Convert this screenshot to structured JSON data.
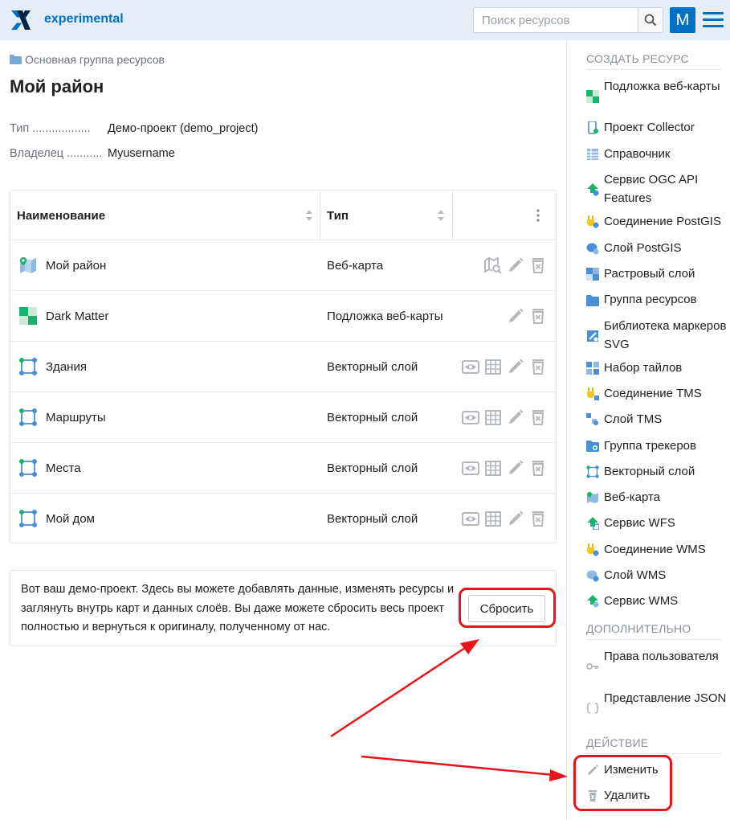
{
  "header": {
    "app_title": "experimental",
    "search_placeholder": "Поиск ресурсов",
    "avatar_letter": "M"
  },
  "breadcrumb": {
    "label": "Основная группа ресурсов"
  },
  "page": {
    "title": "Мой район",
    "meta": [
      {
        "key": "Тип ..................",
        "value": "Демо-проект (demo_project)"
      },
      {
        "key": "Владелец ...........",
        "value": "Myusername"
      }
    ]
  },
  "table": {
    "columns": {
      "name": "Наименование",
      "type": "Тип"
    },
    "rows": [
      {
        "name": "Мой район",
        "type": "Веб-карта",
        "icon": "webmap-icon",
        "actions": [
          "preview-map",
          "edit",
          "delete"
        ]
      },
      {
        "name": "Dark Matter",
        "type": "Подложка веб-карты",
        "icon": "basemap-icon",
        "actions": [
          "edit",
          "delete"
        ]
      },
      {
        "name": "Здания",
        "type": "Векторный слой",
        "icon": "vector-layer-icon",
        "actions": [
          "preview",
          "table",
          "edit",
          "delete"
        ]
      },
      {
        "name": "Маршруты",
        "type": "Векторный слой",
        "icon": "vector-layer-icon",
        "actions": [
          "preview",
          "table",
          "edit",
          "delete"
        ]
      },
      {
        "name": "Места",
        "type": "Векторный слой",
        "icon": "vector-layer-icon",
        "actions": [
          "preview",
          "table",
          "edit",
          "delete"
        ]
      },
      {
        "name": "Мой дом",
        "type": "Векторный слой",
        "icon": "vector-layer-icon",
        "actions": [
          "preview",
          "table",
          "edit",
          "delete"
        ]
      }
    ]
  },
  "notice": {
    "text": "Вот ваш демо-проект. Здесь вы можете добавлять данные, изменять ресурсы и заглянуть внутрь карт и данных слоёв. Вы даже можете сбросить весь проект полностью и вернуться к оригиналу, полученному от нас.",
    "reset_label": "Сбросить"
  },
  "sidebar": {
    "create_title": "СОЗДАТЬ РЕСУРС",
    "create_items": [
      {
        "label": "Подложка веб-карты",
        "icon": "basemap-icon"
      },
      {
        "label": "Проект Collector",
        "icon": "collector-icon"
      },
      {
        "label": "Справочник",
        "icon": "lookup-table-icon"
      },
      {
        "label": "Сервис OGC API Features",
        "icon": "ogcf-service-icon"
      },
      {
        "label": "Соединение PostGIS",
        "icon": "postgis-connection-icon"
      },
      {
        "label": "Слой PostGIS",
        "icon": "postgis-layer-icon"
      },
      {
        "label": "Растровый слой",
        "icon": "raster-layer-icon"
      },
      {
        "label": "Группа ресурсов",
        "icon": "folder-icon"
      },
      {
        "label": "Библиотека маркеров SVG",
        "icon": "svg-marker-library-icon"
      },
      {
        "label": "Набор тайлов",
        "icon": "tileset-icon"
      },
      {
        "label": "Соединение TMS",
        "icon": "tms-connection-icon"
      },
      {
        "label": "Слой TMS",
        "icon": "tms-layer-icon"
      },
      {
        "label": "Группа трекеров",
        "icon": "tracker-group-icon"
      },
      {
        "label": "Векторный слой",
        "icon": "vector-layer-icon"
      },
      {
        "label": "Веб-карта",
        "icon": "webmap-icon"
      },
      {
        "label": "Сервис WFS",
        "icon": "wfs-service-icon"
      },
      {
        "label": "Соединение WMS",
        "icon": "wms-connection-icon"
      },
      {
        "label": "Слой WMS",
        "icon": "wms-layer-icon"
      },
      {
        "label": "Сервис WMS",
        "icon": "wms-service-icon"
      }
    ],
    "extra_title": "ДОПОЛНИТЕЛЬНО",
    "extra_items": [
      {
        "label": "Права пользователя",
        "icon": "key-icon"
      },
      {
        "label": "Представление JSON",
        "icon": "json-braces-icon"
      }
    ],
    "action_title": "ДЕЙСТВИЕ",
    "action_items": [
      {
        "label": "Изменить",
        "icon": "pencil-icon"
      },
      {
        "label": "Удалить",
        "icon": "trash-icon"
      }
    ]
  },
  "colors": {
    "accent": "#0070c5",
    "header_bg": "#e5eef7",
    "highlight": "#e8141c"
  }
}
